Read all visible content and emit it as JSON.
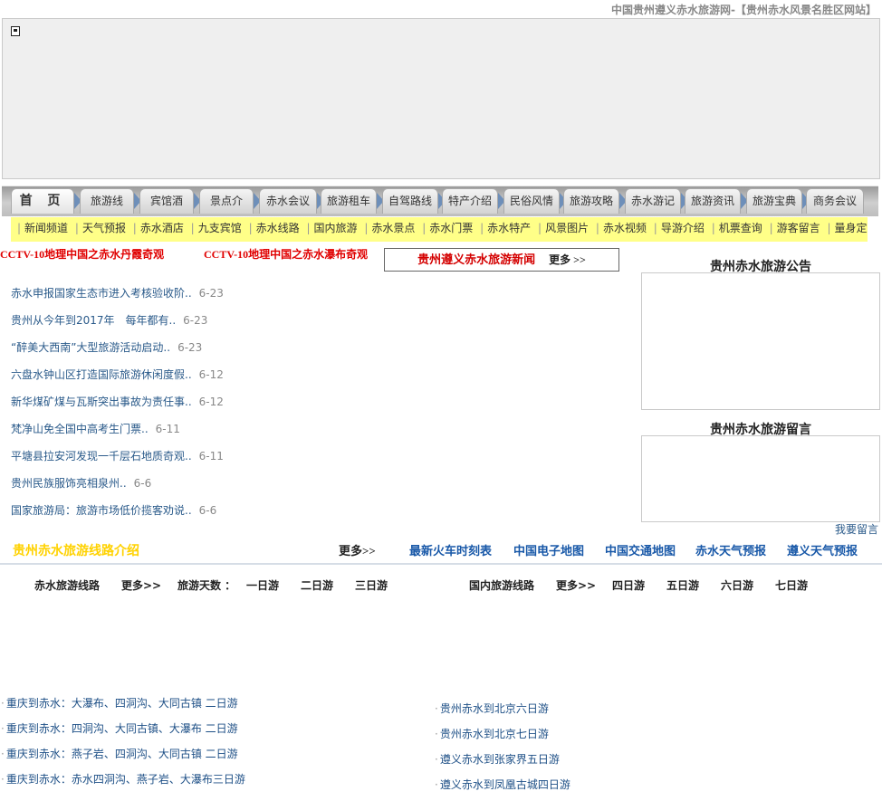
{
  "site_title": "中国贵州遵义赤水旅游网-【贵州赤水风景名胜区网站】",
  "main_nav": [
    {
      "label": "首 页"
    },
    {
      "label": "旅游线路"
    },
    {
      "label": "宾馆酒店"
    },
    {
      "label": "景点介绍"
    },
    {
      "label": "赤水会议"
    },
    {
      "label": "旅游租车"
    },
    {
      "label": "自驾路线"
    },
    {
      "label": "特产介绍"
    },
    {
      "label": "民俗风情"
    },
    {
      "label": "旅游攻略"
    },
    {
      "label": "赤水游记"
    },
    {
      "label": "旅游资讯"
    },
    {
      "label": "旅游宝典"
    },
    {
      "label": "商务会议"
    }
  ],
  "sub_nav": [
    {
      "label": "新闻频道"
    },
    {
      "label": "天气预报"
    },
    {
      "label": "赤水酒店"
    },
    {
      "label": "九支宾馆"
    },
    {
      "label": "赤水线路"
    },
    {
      "label": "国内旅游"
    },
    {
      "label": "赤水景点"
    },
    {
      "label": "赤水门票"
    },
    {
      "label": "赤水特产"
    },
    {
      "label": "风景图片"
    },
    {
      "label": "赤水视频"
    },
    {
      "label": "导游介绍"
    },
    {
      "label": "机票查询"
    },
    {
      "label": "游客留言"
    },
    {
      "label": "量身定制"
    }
  ],
  "cctv_links": [
    {
      "label": "CCTV-10地理中国之赤水丹霞奇观"
    },
    {
      "label": "CCTV-10地理中国之赤水瀑布奇观"
    }
  ],
  "news": {
    "title": "贵州遵义赤水旅游新闻",
    "more": "更多 >>",
    "items": [
      {
        "title": "赤水申报国家生态市进入考核验收阶..",
        "date": "6-23"
      },
      {
        "title": "贵州从今年到2017年　每年都有..",
        "date": "6-23"
      },
      {
        "title": "“醉美大西南”大型旅游活动启动..",
        "date": "6-23"
      },
      {
        "title": "六盘水钟山区打造国际旅游休闲度假..",
        "date": "6-12"
      },
      {
        "title": "新华煤矿煤与瓦斯突出事故为责任事..",
        "date": "6-12"
      },
      {
        "title": "梵净山免全国中高考生门票..",
        "date": "6-11"
      },
      {
        "title": "平塘县拉安河发现一千层石地质奇观..",
        "date": "6-11"
      },
      {
        "title": "贵州民族服饰亮相泉州..",
        "date": "6-6"
      },
      {
        "title": "国家旅游局：旅游市场低价揽客劝说..",
        "date": "6-6"
      }
    ]
  },
  "sidebar": {
    "notice_title": "贵州赤水旅游公告",
    "message_title": "贵州赤水旅游留言",
    "leave_message": "我要留言"
  },
  "info_bar": {
    "route_intro": "贵州赤水旅游线路介绍",
    "more": "更多>>",
    "links": [
      {
        "label": "最新火车时刻表"
      },
      {
        "label": "中国电子地图"
      },
      {
        "label": "中国交通地图"
      },
      {
        "label": "赤水天气预报"
      },
      {
        "label": "遵义天气预报"
      }
    ]
  },
  "chishui_routes": {
    "title": "赤水旅游线路",
    "more": "更多>>",
    "days_label": "旅游天数 ：",
    "tabs": [
      {
        "label": "一日游"
      },
      {
        "label": "二日游"
      },
      {
        "label": "三日游"
      }
    ],
    "items": [
      {
        "label": "重庆到赤水：大瀑布、四洞沟、大同古镇 二日游"
      },
      {
        "label": "重庆到赤水：四洞沟、大同古镇、大瀑布 二日游"
      },
      {
        "label": "重庆到赤水：燕子岩、四洞沟、大同古镇 二日游"
      },
      {
        "label": "重庆到赤水：赤水四洞沟、燕子岩、大瀑布三日游"
      }
    ]
  },
  "domestic_routes": {
    "title": "国内旅游线路",
    "more": "更多>>",
    "tabs": [
      {
        "label": "四日游"
      },
      {
        "label": "五日游"
      },
      {
        "label": "六日游"
      },
      {
        "label": "七日游"
      }
    ],
    "items": [
      {
        "label": "贵州赤水到北京六日游"
      },
      {
        "label": "贵州赤水到北京七日游"
      },
      {
        "label": "遵义赤水到张家界五日游"
      },
      {
        "label": "遵义赤水到凤凰古城四日游"
      }
    ]
  }
}
